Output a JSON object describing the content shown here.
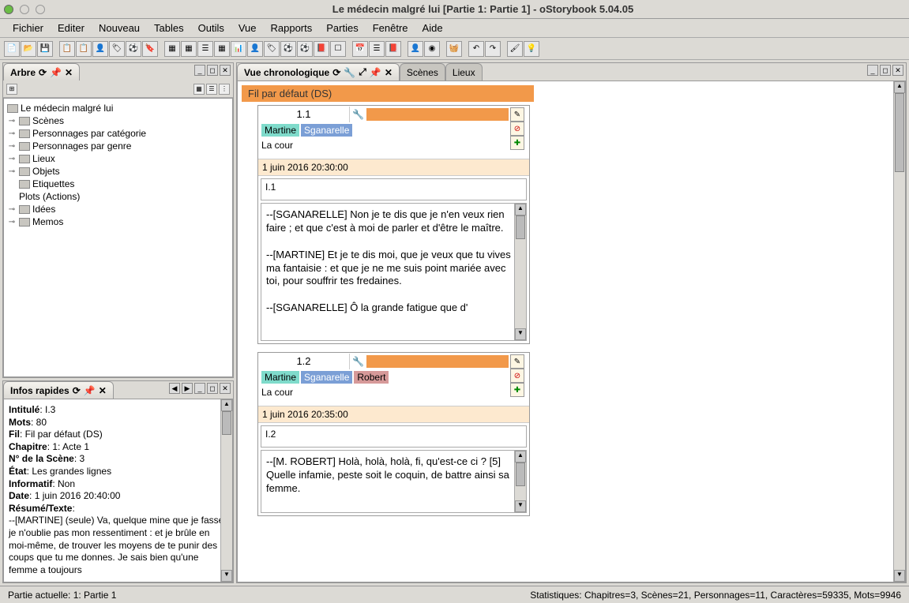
{
  "window_title": "Le médecin malgré lui [Partie 1: Partie 1] - oStorybook 5.04.05",
  "menu": [
    "Fichier",
    "Editer",
    "Nouveau",
    "Tables",
    "Outils",
    "Vue",
    "Rapports",
    "Parties",
    "Fenêtre",
    "Aide"
  ],
  "tree_panel": {
    "title": "Arbre",
    "root": "Le médecin malgré lui",
    "nodes": [
      "Scènes",
      "Personnages par catégorie",
      "Personnages par genre",
      "Lieux",
      "Objets",
      "Etiquettes",
      "Plots (Actions)",
      "Idées",
      "Memos"
    ]
  },
  "info_panel": {
    "title": "Infos rapides",
    "intitule_label": "Intitulé",
    "intitule": "I.3",
    "mots_label": "Mots",
    "mots": "80",
    "fil_label": "Fil",
    "fil": "Fil par défaut (DS)",
    "chapitre_label": "Chapitre",
    "chapitre": "1: Acte 1",
    "nscene_label": "N° de la Scène",
    "nscene": "3",
    "etat_label": "État",
    "etat": "Les grandes lignes",
    "informatif_label": "Informatif",
    "informatif": "Non",
    "date_label": "Date",
    "date": "1 juin 2016 20:40:00",
    "resume_label": "Résumé/Texte",
    "resume": "--[MARTINE] (seule) Va, quelque mine que je fasse, je n'oublie pas mon ressentiment : et je brûle en moi-même, de trouver les moyens de te punir des coups que tu me donnes. Je sais bien qu'une femme a toujours"
  },
  "chrono": {
    "title": "Vue chronologique",
    "tab_scenes": "Scènes",
    "tab_lieux": "Lieux",
    "strand": "Fil par défaut (DS)",
    "scene1": {
      "num": "1.1",
      "chars": {
        "martine": "Martine",
        "sgan": "Sganarelle"
      },
      "loc": "La cour",
      "date": "1 juin 2016 20:30:00",
      "id": "I.1",
      "text_p1": "--[SGANARELLE] Non je te dis que je n'en veux rien faire ; et que c'est à moi de parler et d'être le maître.",
      "text_p2": "--[MARTINE] Et je te dis moi, que je veux que tu vives à ma fantaisie : et que je ne me suis point mariée avec toi, pour souffrir tes fredaines.",
      "text_p3": "--[SGANARELLE] Ô la grande fatigue que d'"
    },
    "scene2": {
      "num": "1.2",
      "chars": {
        "martine": "Martine",
        "sgan": "Sganarelle",
        "robert": "Robert"
      },
      "loc": "La cour",
      "date": "1 juin 2016 20:35:00",
      "id": "I.2",
      "text_p1": "--[M. ROBERT] Holà, holà, holà, fi, qu'est-ce ci ? [5] Quelle infamie, peste soit le coquin, de battre ainsi sa femme."
    }
  },
  "status": {
    "left": "Partie actuelle: 1: Partie 1",
    "right": "Statistiques: Chapitres=3,  Scènes=21,  Personnages=11,  Caractères=59335,  Mots=9946"
  }
}
